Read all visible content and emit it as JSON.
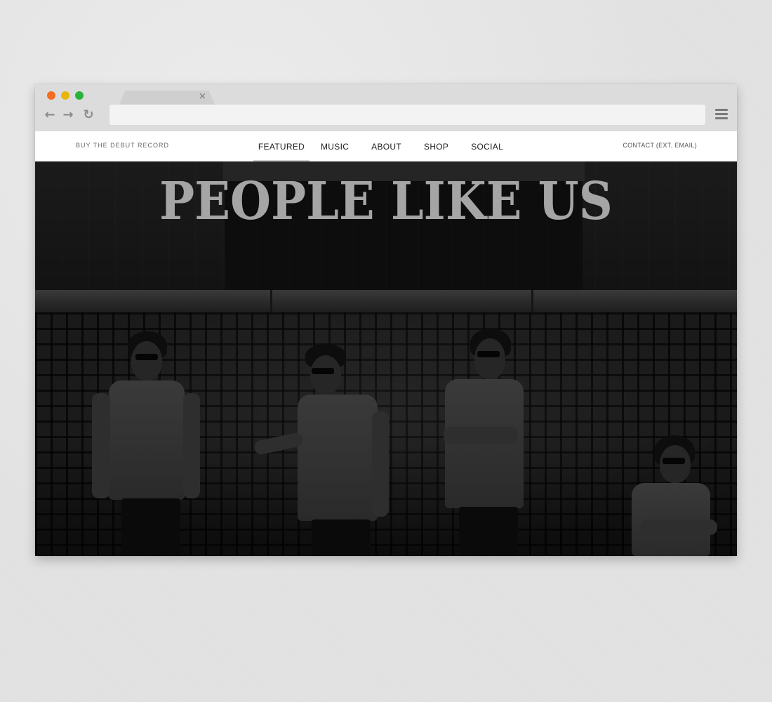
{
  "browser": {
    "tab_close": "×",
    "address_value": "",
    "colors": {
      "traffic_red": "#f46c1f",
      "traffic_yellow": "#e8b50f",
      "traffic_green": "#29b23c"
    }
  },
  "site_nav": {
    "left_link": "BUY THE DEBUT RECORD",
    "links": [
      "FEATURED",
      "MUSIC",
      "ABOUT",
      "SHOP",
      "SOCIAL"
    ],
    "active": "FEATURED",
    "right_link": "CONTACT (EXT. EMAIL)"
  },
  "hero": {
    "title": "PEOPLE LIKE US"
  }
}
